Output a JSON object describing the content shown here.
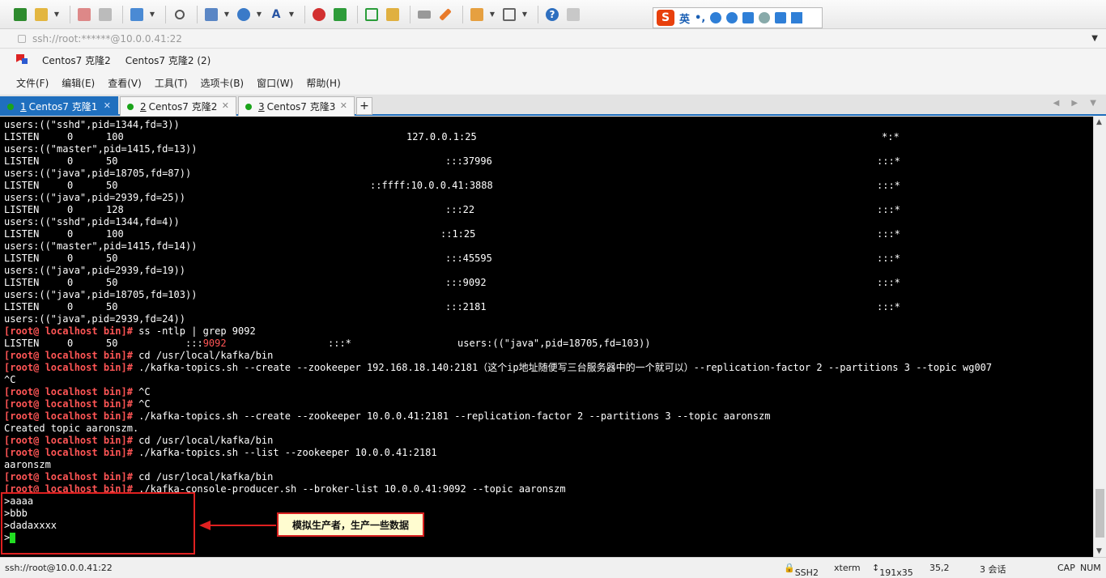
{
  "toolbar": {
    "icons": [
      "new-session-icon",
      "open-folder-icon",
      "disconnect-icon",
      "reconnect-icon",
      "new-window-icon",
      "search-icon",
      "transfer-icon",
      "globe-icon",
      "font-icon",
      "xshell-icon",
      "xftp-icon",
      "fullscreen-icon",
      "lock-icon",
      "keyboard-icon",
      "highlight-icon",
      "compose-icon",
      "layout-icon",
      "help-icon",
      "chat-icon"
    ],
    "ime": {
      "label": "英",
      "punct": "•,"
    }
  },
  "address": {
    "text": "ssh://root:******@10.0.0.41:22"
  },
  "sessions": {
    "items": [
      "Centos7 克隆2",
      "Centos7 克隆2 (2)"
    ]
  },
  "menu": {
    "items": [
      "文件(F)",
      "编辑(E)",
      "查看(V)",
      "工具(T)",
      "选项卡(B)",
      "窗口(W)",
      "帮助(H)"
    ]
  },
  "tabs": [
    {
      "num": "1",
      "label": "Centos7 克隆1",
      "active": true
    },
    {
      "num": "2",
      "label": "Centos7 克隆2",
      "active": false
    },
    {
      "num": "3",
      "label": "Centos7 克隆3",
      "active": false
    }
  ],
  "terminal": {
    "listen_rows": [
      {
        "users": "users:((\"sshd\",pid=1344,fd=3))",
        "state": "LISTEN",
        "recv": "0",
        "send": "100",
        "local": "127.0.0.1:25",
        "peer": "*:*"
      },
      {
        "users": "users:((\"master\",pid=1415,fd=13))",
        "state": "LISTEN",
        "recv": "0",
        "send": "50",
        "local": ":::37996",
        "peer": ":::*"
      },
      {
        "users": "users:((\"java\",pid=18705,fd=87))",
        "state": "LISTEN",
        "recv": "0",
        "send": "50",
        "local": "::ffff:10.0.0.41:3888",
        "peer": ":::*"
      },
      {
        "users": "users:((\"java\",pid=2939,fd=25))",
        "state": "LISTEN",
        "recv": "0",
        "send": "128",
        "local": ":::22",
        "peer": ":::*"
      },
      {
        "users": "users:((\"sshd\",pid=1344,fd=4))",
        "state": "LISTEN",
        "recv": "0",
        "send": "100",
        "local": "::1:25",
        "peer": ":::*"
      },
      {
        "users": "users:((\"master\",pid=1415,fd=14))",
        "state": "LISTEN",
        "recv": "0",
        "send": "50",
        "local": ":::45595",
        "peer": ":::*"
      },
      {
        "users": "users:((\"java\",pid=2939,fd=19))",
        "state": "LISTEN",
        "recv": "0",
        "send": "50",
        "local": ":::9092",
        "peer": ":::*"
      },
      {
        "users": "users:((\"java\",pid=18705,fd=103))",
        "state": "LISTEN",
        "recv": "0",
        "send": "50",
        "local": ":::2181",
        "peer": ":::*"
      }
    ],
    "last_users": "users:((\"java\",pid=2939,fd=24))",
    "prompt": "[root@ localhost bin]#",
    "cmd_grep": " ss -ntlp | grep 9092",
    "grep_result": {
      "state": "LISTEN",
      "recv": "0",
      "send": "50",
      "local_prefix": ":::",
      "local_hl": "9092",
      "peer": ":::*",
      "users": "users:((\"java\",pid=18705,fd=103))"
    },
    "cmd_cd1": " cd /usr/local/kafka/bin",
    "cmd_create1": " ./kafka-topics.sh --create --zookeeper 192.168.18.140:2181（这个ip地址随便写三台服务器中的一个就可以）--replication-factor 2 --partitions 3 --topic wg007",
    "ctrl_c": "^C",
    "cmd_ctrl_c1": " ^C",
    "cmd_ctrl_c2": " ^C",
    "cmd_create2": " ./kafka-topics.sh --create --zookeeper 10.0.0.41:2181 --replication-factor 2 --partitions 3 --topic aaronszm",
    "created": "Created topic aaronszm.",
    "cmd_cd2": " cd /usr/local/kafka/bin",
    "cmd_list": " ./kafka-topics.sh --list --zookeeper 10.0.0.41:2181",
    "list_result": "aaronszm",
    "cmd_cd3": " cd /usr/local/kafka/bin",
    "cmd_producer": " ./kafka-console-producer.sh --broker-list 10.0.0.41:9092 --topic aaronszm",
    "producer_input": [
      ">aaaa",
      ">bbb",
      ">dadaxxxx",
      ">"
    ]
  },
  "annotation": {
    "callout": "模拟生产者，生产一些数据",
    "box_color": "#e02020"
  },
  "status": {
    "address": "ssh://root@10.0.0.41:22",
    "protocol": "SSH2",
    "term": "xterm",
    "size": "191x35",
    "pos": "35,2",
    "sessions": "3 会话",
    "caps": "CAP",
    "num": "NUM"
  }
}
